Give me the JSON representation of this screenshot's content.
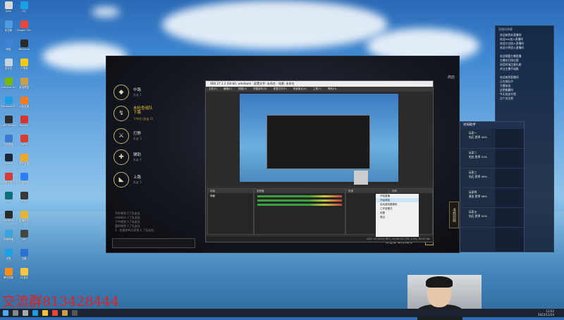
{
  "desktop": {
    "icons": [
      {
        "label": "Adm",
        "color": "#d8d8d8"
      },
      {
        "label": "QQ",
        "color": "#1aa1e6"
      },
      {
        "label": "此电脑",
        "color": "#4f9be0"
      },
      {
        "label": "Google Chrome",
        "color": "#e8453c"
      },
      {
        "label": "网络",
        "color": "#3e83d8"
      },
      {
        "label": "WeGame",
        "color": "#2a2a2a"
      },
      {
        "label": "回收站",
        "color": "#c7d3dd"
      },
      {
        "label": "YY语音",
        "color": "#f6c915"
      },
      {
        "label": "GeForce Experience",
        "color": "#76b900"
      },
      {
        "label": "英雄联盟",
        "color": "#c8a04c"
      },
      {
        "label": "Microsoft Edge",
        "color": "#1e9de3"
      },
      {
        "label": "斗鱼直播",
        "color": "#ff7a1a"
      },
      {
        "label": "OBS Studio",
        "color": "#302e31"
      },
      {
        "label": "Tencent",
        "color": "#d8322c"
      },
      {
        "label": "控制面板",
        "color": "#3d7ad1"
      },
      {
        "label": "WPS",
        "color": "#d93c2c"
      },
      {
        "label": "Steam",
        "color": "#1b2838"
      },
      {
        "label": "虎牙直播",
        "color": "#f5a623"
      },
      {
        "label": "网易云音乐",
        "color": "#d43c33"
      },
      {
        "label": "百度网盘",
        "color": "#2b7ff2"
      },
      {
        "label": "LOL",
        "color": "#0d6f7c"
      },
      {
        "label": "TGP",
        "color": "#393939"
      },
      {
        "label": "WeGame",
        "color": "#2a2a2a"
      },
      {
        "label": "直播助手",
        "color": "#e4b433"
      },
      {
        "label": "哔哩哔哩",
        "color": "#3ba3db"
      },
      {
        "label": "OBS",
        "color": "#444444"
      },
      {
        "label": "优酷",
        "color": "#1fa0e6"
      },
      {
        "label": "迅雷",
        "color": "#2a72d8"
      },
      {
        "label": "腾讯视频",
        "color": "#ff8d1a"
      },
      {
        "label": "QQ音乐",
        "color": "#f8c73d"
      }
    ]
  },
  "launcher": {
    "lanes": [
      {
        "icon": "◆",
        "name": "中路",
        "sub": "队友 1",
        "selected": false
      },
      {
        "icon": "↯",
        "name": "未检查组队\n下路",
        "sub": "下中位 (队友 2)",
        "selected": true
      },
      {
        "icon": "⚔",
        "name": "打野",
        "sub": "队友 3",
        "selected": false
      },
      {
        "icon": "✚",
        "name": "辅助",
        "sub": "队友 4",
        "selected": false
      },
      {
        "icon": "◣",
        "name": "上路",
        "sub": "队友 5",
        "selected": false
      }
    ],
    "notice_lines": [
      "平护收到 1了队友队",
      "middlen 1了队友队",
      "下中收到 1了队友队",
      "暂时收到 1了队友队",
      "1 · 在保护的分享到 1 了队友队"
    ],
    "top_right": "商店",
    "match_button": "寻找对局",
    "bottom_text": "排位赛 单排/双排"
  },
  "obs": {
    "title": "OBS 27.1.3 (64-bit, windows) - 配置文件: 未命名 - 场景: 未命名",
    "menu": [
      "文件(F)",
      "编辑(E)",
      "视图(V)",
      "停靠部件(D)",
      "配置文件(P)",
      "场景集合(S)",
      "工具(T)",
      "帮助(H)"
    ],
    "scene_dock": "场景",
    "scene_name": "场景",
    "mixer_dock": "混音器",
    "source_dock": "来源",
    "controls_dock": "控制",
    "context_menu": [
      "开始直播",
      "开始录制",
      "启动虚拟摄像机",
      "工作室模式",
      "设置",
      "退出"
    ],
    "status": "LIVE: 00:00:00  REC: 00:00:00  CPU: 2.4%, 60.00 fps"
  },
  "chat": {
    "header": "直播间弹幕",
    "messages": [
      "欢迎来到本直播间",
      "欢迎vivi加入直播间",
      "欢迎小白加入直播间",
      "欢迎小明进入直播间",
      "",
      "欢迎观看主播直播",
      "主播在打排位赛",
      "说话时请注意礼貌",
      "关注主播不迷路",
      "",
      "欢迎来到直播间",
      "正在排队中",
      "主播加油",
      "这把能赢吗",
      "今天状态不错",
      "点个关注吧"
    ]
  },
  "helper": {
    "header": "对局助手",
    "items": [
      {
        "name": "玩家一",
        "detail": "钻石 胜率 54%"
      },
      {
        "name": "玩家二",
        "detail": "铂金 胜率 51%"
      },
      {
        "name": "玩家三",
        "detail": "钻石 胜率 49%"
      },
      {
        "name": "玩家四",
        "detail": "黄金 胜率 56%"
      },
      {
        "name": "玩家五",
        "detail": "钻石 胜率 52%"
      }
    ]
  },
  "overlay": {
    "qq_group": "交流群813428444"
  },
  "taskbar": {
    "time": "13:02",
    "date": "2022/11/24"
  }
}
